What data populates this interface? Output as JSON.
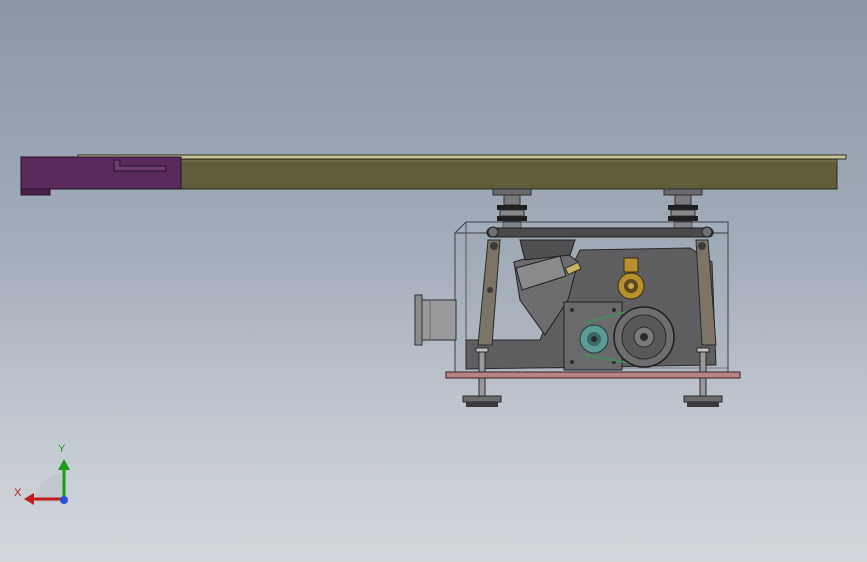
{
  "view": {
    "title": "",
    "triad": {
      "y_label": "Y",
      "x_label": "X",
      "y_color": "#1a9c1a",
      "x_color": "#c01a1a",
      "z_color": "#2a4fd4"
    }
  },
  "colors": {
    "background_top": "#8b97a7",
    "background_bottom": "#d3d7dc",
    "tray": "#5f5c3a",
    "tray_end": "#5b2a5c",
    "housing_outline": "#3a3f46",
    "frame": "#5e5e60",
    "base_plate": "#b58585",
    "pulley_teal": "#5b9b95",
    "bearing_gold": "#b8912e"
  },
  "parts": [
    "feeder-tray",
    "tray-end-cap",
    "spring-mount-left",
    "spring-mount-right",
    "housing",
    "side-frame",
    "swing-arm-left",
    "swing-arm-right",
    "motor-block",
    "bearing",
    "drive-pulley",
    "driven-pulley",
    "base-plate",
    "leveling-foot-left",
    "leveling-foot-right",
    "outlet-flange"
  ]
}
